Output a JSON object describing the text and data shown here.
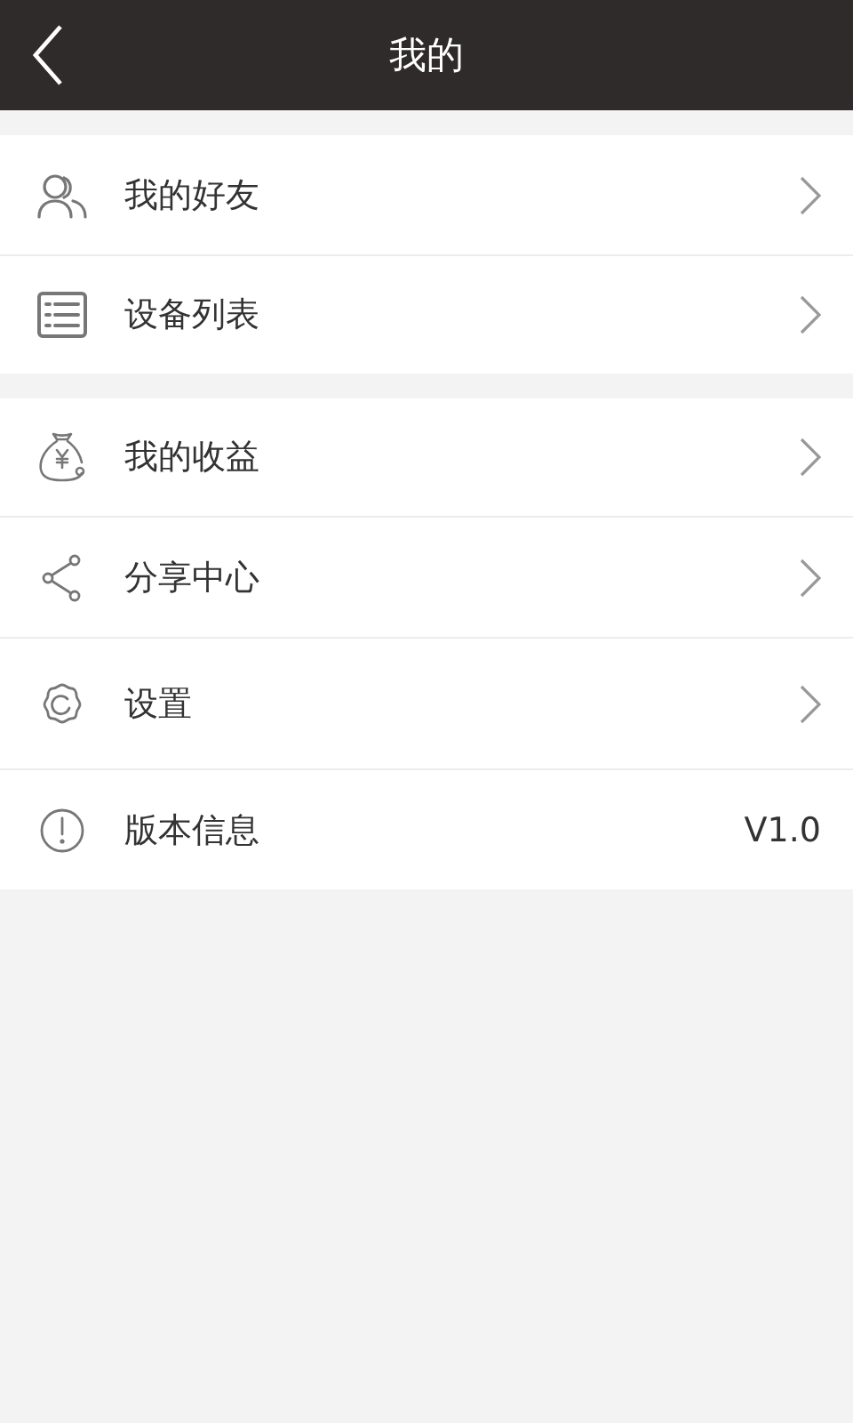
{
  "header": {
    "title": "我的"
  },
  "groups": [
    {
      "items": [
        {
          "kind": "link",
          "label": "我的好友"
        },
        {
          "kind": "link",
          "label": "设备列表"
        }
      ]
    },
    {
      "items": [
        {
          "kind": "link",
          "label": "我的收益"
        },
        {
          "kind": "link",
          "label": "分享中心"
        },
        {
          "kind": "link",
          "label": "设置"
        },
        {
          "kind": "value",
          "label": "版本信息",
          "value": "V1.0"
        }
      ]
    }
  ]
}
